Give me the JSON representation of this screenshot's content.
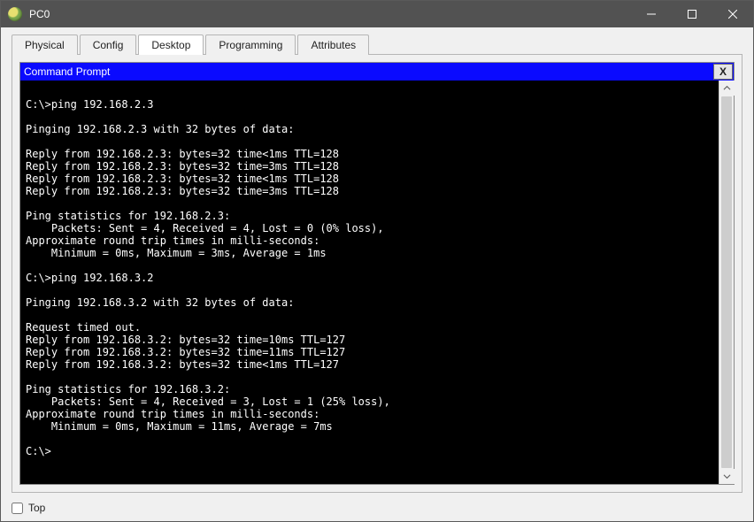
{
  "window": {
    "title": "PC0"
  },
  "tabs": [
    {
      "label": "Physical"
    },
    {
      "label": "Config"
    },
    {
      "label": "Desktop"
    },
    {
      "label": "Programming"
    },
    {
      "label": "Attributes"
    }
  ],
  "active_tab_index": 2,
  "command_prompt": {
    "title": "Command Prompt",
    "close_label": "X",
    "lines": [
      "",
      "C:\\>ping 192.168.2.3",
      "",
      "Pinging 192.168.2.3 with 32 bytes of data:",
      "",
      "Reply from 192.168.2.3: bytes=32 time<1ms TTL=128",
      "Reply from 192.168.2.3: bytes=32 time=3ms TTL=128",
      "Reply from 192.168.2.3: bytes=32 time<1ms TTL=128",
      "Reply from 192.168.2.3: bytes=32 time=3ms TTL=128",
      "",
      "Ping statistics for 192.168.2.3:",
      "    Packets: Sent = 4, Received = 4, Lost = 0 (0% loss),",
      "Approximate round trip times in milli-seconds:",
      "    Minimum = 0ms, Maximum = 3ms, Average = 1ms",
      "",
      "C:\\>ping 192.168.3.2",
      "",
      "Pinging 192.168.3.2 with 32 bytes of data:",
      "",
      "Request timed out.",
      "Reply from 192.168.3.2: bytes=32 time=10ms TTL=127",
      "Reply from 192.168.3.2: bytes=32 time=11ms TTL=127",
      "Reply from 192.168.3.2: bytes=32 time<1ms TTL=127",
      "",
      "Ping statistics for 192.168.3.2:",
      "    Packets: Sent = 4, Received = 3, Lost = 1 (25% loss),",
      "Approximate round trip times in milli-seconds:",
      "    Minimum = 0ms, Maximum = 11ms, Average = 7ms",
      "",
      "C:\\>"
    ]
  },
  "footer": {
    "top_label": "Top",
    "top_checked": false
  }
}
